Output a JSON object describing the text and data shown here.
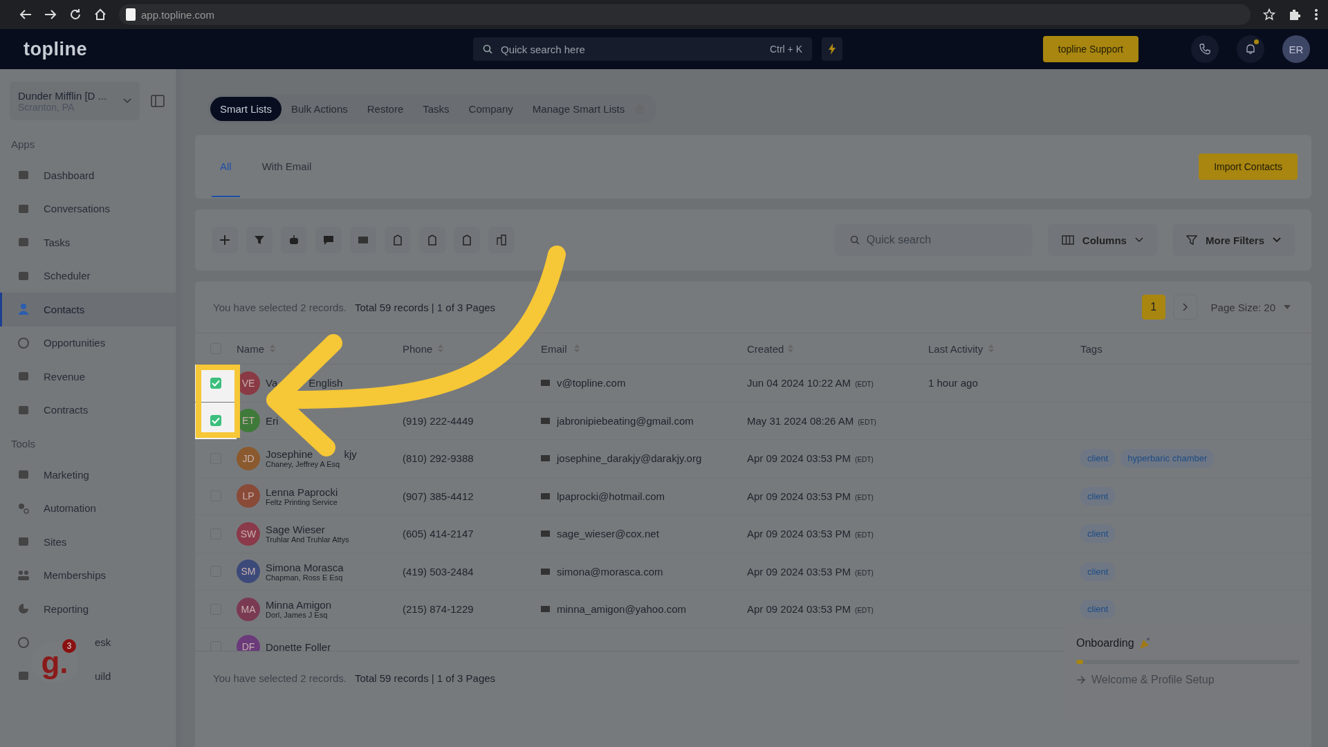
{
  "browser": {
    "url": "app.topline.com"
  },
  "nav": {
    "logo": "topline",
    "search_placeholder": "Quick search here",
    "shortcut": "Ctrl + K",
    "support": "topline Support",
    "avatar": "ER",
    "bell_dot": true
  },
  "workspace": {
    "name": "Dunder Mifflin [D ...",
    "location": "Scranton, PA"
  },
  "sidebar": {
    "sections": [
      {
        "title": "Apps",
        "items": [
          {
            "label": "Dashboard",
            "selected": false
          },
          {
            "label": "Conversations",
            "selected": false
          },
          {
            "label": "Tasks",
            "selected": false
          },
          {
            "label": "Scheduler",
            "selected": false
          },
          {
            "label": "Contacts",
            "selected": true
          },
          {
            "label": "Opportunities",
            "selected": false
          },
          {
            "label": "Revenue",
            "selected": false
          },
          {
            "label": "Contracts",
            "selected": false
          }
        ]
      },
      {
        "title": "Tools",
        "items": [
          {
            "label": "Marketing",
            "selected": false
          },
          {
            "label": "Automation",
            "selected": false
          },
          {
            "label": "Sites",
            "selected": false
          },
          {
            "label": "Memberships",
            "selected": false
          },
          {
            "label": "Reporting",
            "selected": false
          },
          {
            "label": "esk",
            "kind": "covered"
          },
          {
            "label": "uild",
            "kind": "covered"
          }
        ]
      }
    ]
  },
  "top_tabs": [
    {
      "label": "Smart Lists",
      "selected": true
    },
    {
      "label": "Bulk Actions",
      "selected": false
    },
    {
      "label": "Restore",
      "selected": false
    },
    {
      "label": "Tasks",
      "selected": false
    },
    {
      "label": "Company",
      "selected": false
    },
    {
      "label": "Manage Smart Lists",
      "selected": false
    }
  ],
  "list_tabs": [
    {
      "label": "All",
      "selected": true
    },
    {
      "label": "With Email",
      "selected": false
    }
  ],
  "import_button": "Import Contacts",
  "toolbar": {
    "search_placeholder": "Quick search",
    "columns": "Columns",
    "filters": "More Filters"
  },
  "selection_summary": {
    "selected": "You have selected 2 records.",
    "total": "Total 59 records | 1 of 3 Pages"
  },
  "footer_summary": {
    "selected": "You have selected 2 records.",
    "total": "Total 59 records | 1 of 3 Pages"
  },
  "select_all": {
    "checked": false
  },
  "pagination": {
    "pages": [
      {
        "label": "1",
        "selected": true
      }
    ],
    "page_size": "Page Size: 20"
  },
  "table": {
    "columns": [
      "Name",
      "Phone",
      "Email",
      "Created",
      "Last Activity",
      "Tags"
    ],
    "rows": [
      {
        "checked": true,
        "initials": "VE",
        "color": "#8a3a44",
        "name": "Va",
        "name_rest": "English",
        "company": "",
        "phone": "",
        "email": "v@topline.com",
        "created": "Jun 04 2024 10:22 AM",
        "tz": "(EDT)",
        "last_activity": "1 hour ago",
        "tags": []
      },
      {
        "checked": true,
        "initials": "ET",
        "color": "#3f7a3a",
        "name": "Eri",
        "company": "",
        "phone": "(919) 222-4449",
        "email": "jabronipiebeating@gmail.com",
        "created": "May 31 2024 08:26 AM",
        "tz": "(EDT)",
        "last_activity": "",
        "tags": []
      },
      {
        "checked": false,
        "initials": "JD",
        "color": "#8a5a2e",
        "name": "Josephine",
        "name_rest": "kjy",
        "company": "Chaney, Jeffrey A Esq",
        "phone": "(810) 292-9388",
        "email": "josephine_darakjy@darakjy.org",
        "created": "Apr 09 2024 03:53 PM",
        "tz": "(EDT)",
        "last_activity": "",
        "tags": [
          "client",
          "hyperbaric chamber"
        ]
      },
      {
        "checked": false,
        "initials": "LP",
        "color": "#8a4a38",
        "name": "Lenna Paprocki",
        "company": "Feltz Printing Service",
        "phone": "(907) 385-4412",
        "email": "lpaprocki@hotmail.com",
        "created": "Apr 09 2024 03:53 PM",
        "tz": "(EDT)",
        "last_activity": "",
        "tags": [
          "client"
        ]
      },
      {
        "checked": false,
        "initials": "SW",
        "color": "#8a3a4a",
        "name": "Sage Wieser",
        "company": "Truhlar And Truhlar Attys",
        "phone": "(605) 414-2147",
        "email": "sage_wieser@cox.net",
        "created": "Apr 09 2024 03:53 PM",
        "tz": "(EDT)",
        "last_activity": "",
        "tags": [
          "client"
        ]
      },
      {
        "checked": false,
        "initials": "SM",
        "color": "#3c4a7a",
        "name": "Simona Morasca",
        "company": "Chapman, Ross E Esq",
        "phone": "(419) 503-2484",
        "email": "simona@morasca.com",
        "created": "Apr 09 2024 03:53 PM",
        "tz": "(EDT)",
        "last_activity": "",
        "tags": [
          "client"
        ]
      },
      {
        "checked": false,
        "initials": "MA",
        "color": "#7a3a52",
        "name": "Minna Amigon",
        "company": "Dorl, James J Esq",
        "phone": "(215) 874-1229",
        "email": "minna_amigon@yahoo.com",
        "created": "Apr 09 2024 03:53 PM",
        "tz": "(EDT)",
        "last_activity": "",
        "tags": [
          "client"
        ]
      },
      {
        "checked": false,
        "initials": "DF",
        "color": "#6a3a7a",
        "name": "Donette Foller",
        "company": "",
        "phone": "",
        "email": "",
        "created": "",
        "tz": "",
        "last_activity": "",
        "tags": []
      }
    ]
  },
  "onboarding": {
    "title": "Onboarding",
    "level": 0.03,
    "step": "Welcome & Profile Setup"
  },
  "helper": {
    "logo": "g.",
    "badge": "3"
  }
}
